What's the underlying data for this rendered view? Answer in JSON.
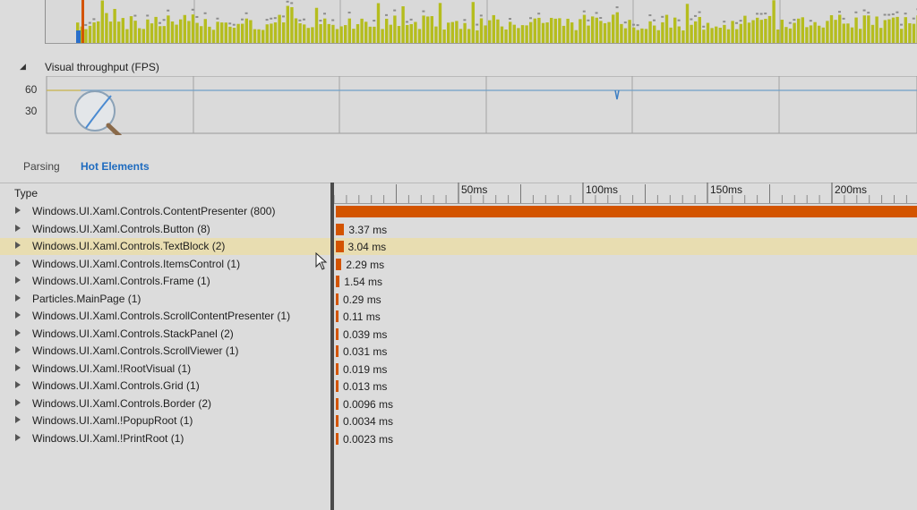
{
  "fps": {
    "title": "Visual throughput (FPS)",
    "ticks": [
      "60",
      "30"
    ]
  },
  "tabs": {
    "parsing": "Parsing",
    "hot_elements": "Hot Elements"
  },
  "table": {
    "type_header": "Type",
    "ruler_labels": [
      "50ms",
      "100ms",
      "150ms",
      "200ms"
    ],
    "rows": [
      {
        "name": "Windows.UI.Xaml.Controls.ContentPresenter (800)",
        "ms": "",
        "value_ms": 236
      },
      {
        "name": "Windows.UI.Xaml.Controls.Button (8)",
        "ms": "3.37 ms",
        "value_ms": 3.37
      },
      {
        "name": "Windows.UI.Xaml.Controls.TextBlock (2)",
        "ms": "3.04 ms",
        "value_ms": 3.04
      },
      {
        "name": "Windows.UI.Xaml.Controls.ItemsControl (1)",
        "ms": "2.29 ms",
        "value_ms": 2.29
      },
      {
        "name": "Windows.UI.Xaml.Controls.Frame (1)",
        "ms": "1.54 ms",
        "value_ms": 1.54
      },
      {
        "name": "Particles.MainPage (1)",
        "ms": "0.29 ms",
        "value_ms": 0.29
      },
      {
        "name": "Windows.UI.Xaml.Controls.ScrollContentPresenter (1)",
        "ms": "0.11 ms",
        "value_ms": 0.11
      },
      {
        "name": "Windows.UI.Xaml.Controls.StackPanel (2)",
        "ms": "0.039 ms",
        "value_ms": 0.039
      },
      {
        "name": "Windows.UI.Xaml.Controls.ScrollViewer (1)",
        "ms": "0.031 ms",
        "value_ms": 0.031
      },
      {
        "name": "Windows.UI.Xaml.!RootVisual (1)",
        "ms": "0.019 ms",
        "value_ms": 0.019
      },
      {
        "name": "Windows.UI.Xaml.Controls.Grid (1)",
        "ms": "0.013 ms",
        "value_ms": 0.013
      },
      {
        "name": "Windows.UI.Xaml.Controls.Border (2)",
        "ms": "0.0096 ms",
        "value_ms": 0.0096
      },
      {
        "name": "Windows.UI.Xaml.!PopupRoot (1)",
        "ms": "0.0034 ms",
        "value_ms": 0.0034
      },
      {
        "name": "Windows.UI.Xaml.!PrintRoot (1)",
        "ms": "0.0023 ms",
        "value_ms": 0.0023
      }
    ],
    "selected_index": 2
  },
  "colors": {
    "bar": "#d35400",
    "histogram_bar": "#b5bd1e",
    "histogram_blue": "#2a6fc9",
    "fps_line": "#6f9fc8",
    "selected_row": "#e8ddb1",
    "accent_tab": "#1e6bbf"
  },
  "icons": {
    "magnifier": "magnifier-icon",
    "expander": "expand-triangle-icon",
    "collapse": "collapse-triangle-icon",
    "cursor": "mouse-cursor-icon"
  }
}
